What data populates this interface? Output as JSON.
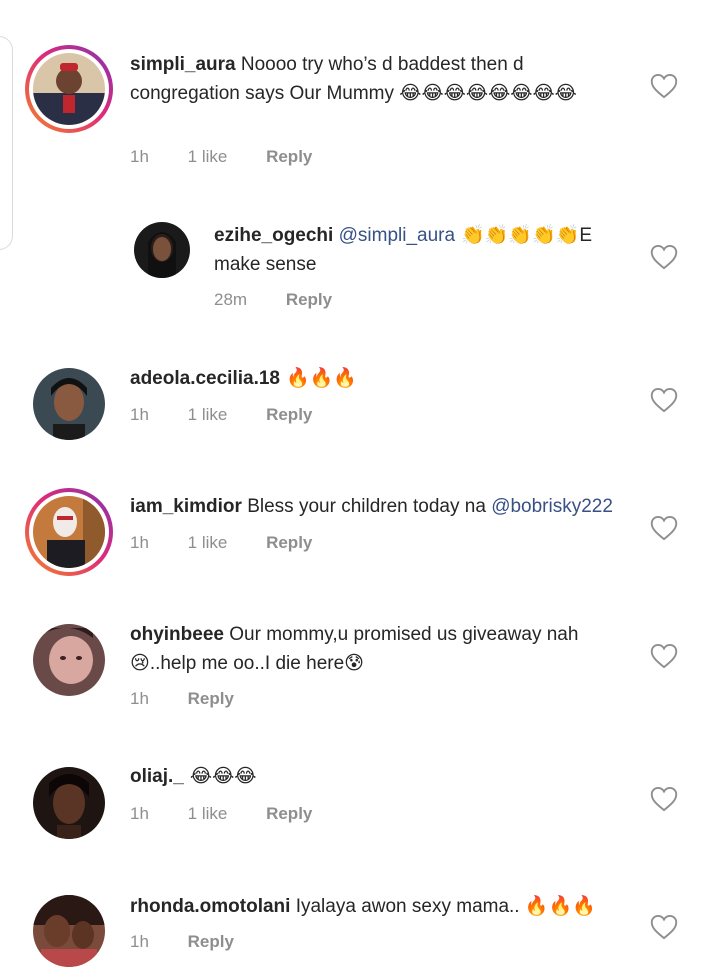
{
  "comments": [
    {
      "username": "simpli_aura",
      "text": " Noooo try who’s d baddest then d congregation says Our Mummy ",
      "emoji": "😂😂😂😂😂😂😂😂",
      "time": "1h",
      "likes": "1 like",
      "reply": "Reply",
      "story_ring": true
    },
    {
      "username": "ezihe_ogechi",
      "mention": "@simpli_aura",
      "emoji": " 👏👏👏👏👏",
      "text": "E make sense",
      "time": "28m",
      "reply": "Reply",
      "is_reply": true
    },
    {
      "username": "adeola.cecilia.18",
      "emoji": " 🔥🔥🔥",
      "time": "1h",
      "likes": "1 like",
      "reply": "Reply"
    },
    {
      "username": "iam_kimdior",
      "text": " Bless your children today na ",
      "mention": "@bobrisky222",
      "time": "1h",
      "likes": "1 like",
      "reply": "Reply",
      "story_ring": true
    },
    {
      "username": "ohyinbeee",
      "text": " Our mommy,u promised us giveaway nah ",
      "emoji": "😢",
      "text2": "..help me oo..I die here",
      "emoji2": "😰",
      "time": "1h",
      "reply": "Reply"
    },
    {
      "username": "oliaj._",
      "emoji": " 😂😂😂",
      "time": "1h",
      "likes": "1 like",
      "reply": "Reply"
    },
    {
      "username": "rhonda.omotolani",
      "text": " Iyalaya awon sexy mama.. ",
      "emoji": "🔥🔥🔥",
      "time": "1h",
      "reply": "Reply"
    }
  ],
  "icons": {
    "heart": "heart-outline-icon"
  },
  "colors": {
    "text": "#262626",
    "meta": "#8e8e8e",
    "mention": "#385185"
  }
}
